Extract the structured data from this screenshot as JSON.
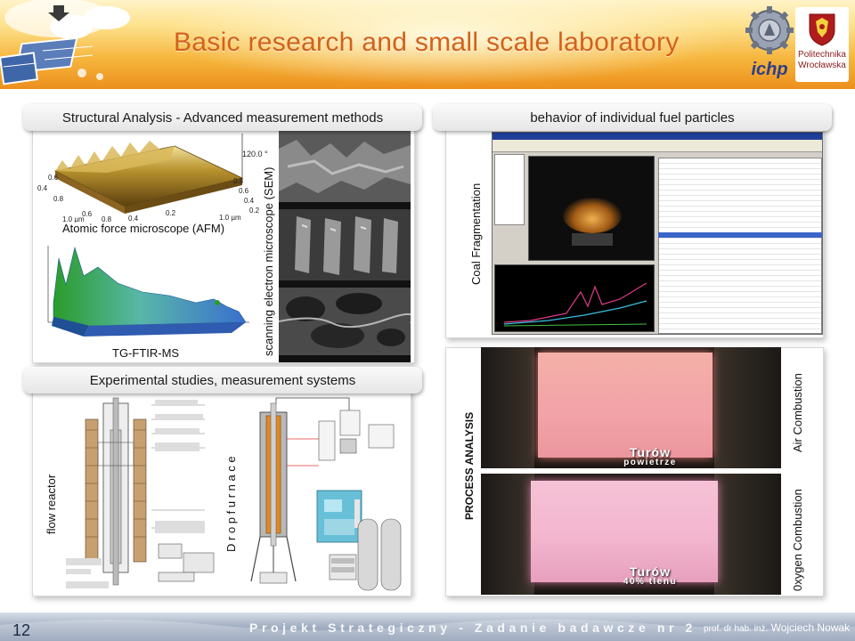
{
  "slide": {
    "title": "Basic research and small scale laboratory",
    "page_number": "12",
    "footer_project": "Projekt Strategiczny - Zadanie badawcze nr 2",
    "author_prefix": "prof. dr hab. inż.",
    "author_name": "Wojciech Nowak"
  },
  "logos": {
    "ichp": "ichp",
    "pwr_line1": "Politechnika",
    "pwr_line2": "Wrocławska"
  },
  "structural": {
    "header": "Structural Analysis - Advanced measurement methods",
    "afm_caption": "Atomic force microscope (AFM)",
    "tgftir_caption": "TG-FTIR-MS",
    "sem_caption": "scanning electron microscope (SEM)",
    "afm_z_label": "120.0 °",
    "afm_tick_08": "0.8",
    "afm_tick_06": "0.6",
    "afm_tick_04": "0.4",
    "afm_tick_02": "0.2",
    "afm_tick_10um": "1.0 µm",
    "afm_tick_02b": "0.2",
    "afm_tick_04b": "0.4",
    "afm_tick_06b": "0.6",
    "afm_tick_08b": "0.8",
    "afm_tick_10umb": "1.0 µm",
    "afm_tick_left04": "0.4",
    "afm_tick_left06": "0.6",
    "afm_tick_left08": "0.8"
  },
  "fuel": {
    "header": "behavior of individual fuel particles",
    "coal_caption": "Coal Fragmentation"
  },
  "experimental": {
    "header": "Experimental studies,  measurement systems",
    "flow_caption": "flow reactor",
    "drop_caption": "D r o p   f u r n a c e"
  },
  "process": {
    "caption": "PROCESS ANALYSIS",
    "air_caption": "Air Combustion",
    "oxy_caption": "0xygen Combustion",
    "turow_air_line1": "Turów",
    "turow_air_line2": "powietrze",
    "turow_oxy_line1": "Turów",
    "turow_oxy_line2": "40% tlenu"
  },
  "colors": {
    "title": "#d2611a",
    "header_orange": "#ec8f1c",
    "flame_air": "#f2a2a8",
    "flame_oxy": "#f3b6cf",
    "dark_bg": "#1a1612"
  }
}
